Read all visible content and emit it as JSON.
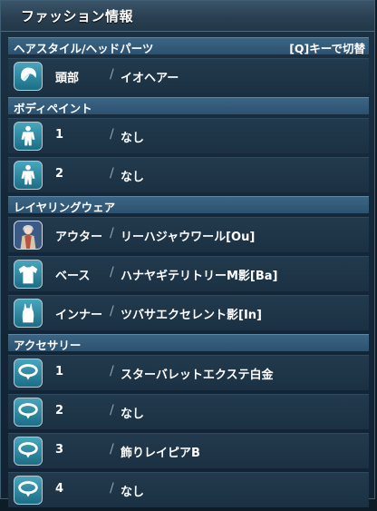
{
  "window": {
    "title": "ファッション情報"
  },
  "sections": {
    "hair": {
      "title": "ヘアスタイル/ヘッドパーツ",
      "hint": "[Q]キーで切替",
      "rows": [
        {
          "label": "頭部",
          "value": "イオヘアー",
          "icon": "hair-icon"
        }
      ]
    },
    "bodypaint": {
      "title": "ボディペイント",
      "rows": [
        {
          "label": "1",
          "value": "なし",
          "icon": "body-paint-icon"
        },
        {
          "label": "2",
          "value": "なし",
          "icon": "body-paint-icon"
        }
      ]
    },
    "layered": {
      "title": "レイヤリングウェア",
      "rows": [
        {
          "label": "アウター",
          "value": "リーハジャウワール[Ou]",
          "icon": "outer-portrait-icon"
        },
        {
          "label": "ベース",
          "value": "ハナヤギテリトリーM影[Ba]",
          "icon": "shirt-icon"
        },
        {
          "label": "インナー",
          "value": "ツバサエクセレント影[In]",
          "icon": "tank-top-icon"
        }
      ]
    },
    "accessory": {
      "title": "アクセサリー",
      "rows": [
        {
          "label": "1",
          "value": "スターバレットエクステ白金",
          "icon": "necklace-icon"
        },
        {
          "label": "2",
          "value": "なし",
          "icon": "necklace-icon"
        },
        {
          "label": "3",
          "value": "飾りレイピアB",
          "icon": "necklace-icon"
        },
        {
          "label": "4",
          "value": "なし",
          "icon": "necklace-icon"
        }
      ]
    }
  },
  "colors": {
    "accent": "#2c5270",
    "row": "#1b3143",
    "icon": "#1b6e86"
  }
}
